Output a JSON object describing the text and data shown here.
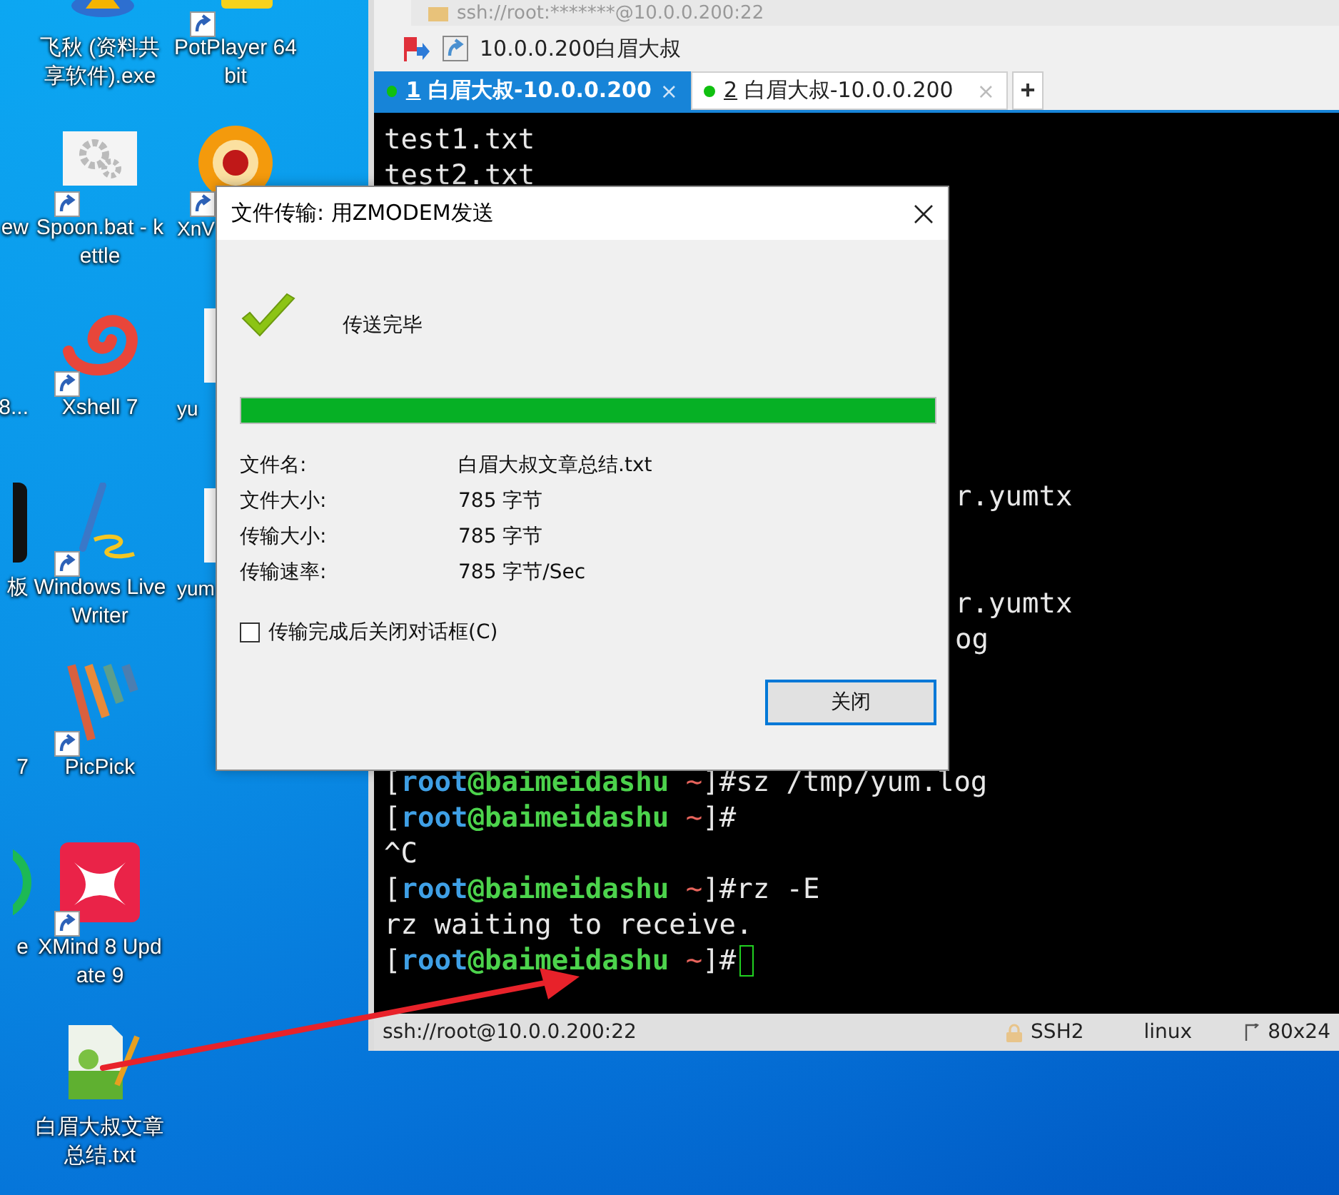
{
  "desktop": {
    "columns": [
      {
        "icons": [
          {
            "label": "ew",
            "kind": "cut"
          },
          {
            "label": "8...",
            "kind": "cut"
          },
          {
            "label": "板",
            "kind": "cut"
          },
          {
            "label": "7",
            "kind": "cut"
          },
          {
            "label": "e",
            "kind": "cut"
          }
        ]
      },
      {
        "icons": [
          {
            "label": "飞秋 (资料共享软件).exe",
            "kind": "full",
            "shortcut": false
          },
          {
            "label": "Spoon.bat - kettle",
            "kind": "full",
            "shortcut": true
          },
          {
            "label": "Xshell 7",
            "kind": "full",
            "shortcut": true
          },
          {
            "label": "Windows Live Writer",
            "kind": "full",
            "shortcut": true
          },
          {
            "label": "PicPick",
            "kind": "full",
            "shortcut": true
          },
          {
            "label": "XMind 8 Update 9",
            "kind": "full",
            "shortcut": true
          },
          {
            "label": "白眉大叔文章总结.txt",
            "kind": "full",
            "shortcut": false
          }
        ]
      },
      {
        "icons": [
          {
            "label": "PotPlayer 64 bit",
            "kind": "full",
            "shortcut": true
          },
          {
            "label": "XnV",
            "kind": "cut",
            "shortcut": true
          },
          {
            "label": "yu",
            "kind": "cut",
            "shortcut": false
          },
          {
            "label": "yum",
            "kind": "cut",
            "shortcut": false
          }
        ]
      }
    ]
  },
  "terminal_window": {
    "address": "ssh://root:*******@10.0.0.200:22",
    "session": "10.0.0.200白眉大叔",
    "tabs": [
      {
        "number": "1",
        "title": "白眉大叔-10.0.0.200",
        "close": "×",
        "selected": true,
        "connected": true
      },
      {
        "number": "2",
        "title": "白眉大叔-10.0.0.200",
        "close": "×",
        "selected": false,
        "connected": true
      }
    ],
    "new_tab": "+",
    "terminal": {
      "groups": [
        {
          "kind": "full",
          "lines": [
            {
              "segments": [
                {
                  "text": "test1.txt",
                  "kind": "plain"
                }
              ]
            },
            {
              "segments": [
                {
                  "text": "test2.txt",
                  "kind": "plain"
                }
              ]
            }
          ]
        },
        {
          "kind": "beside",
          "lines": [
            {
              "segments": [
                {
                  "text": "r.yumtx",
                  "kind": "plain"
                }
              ]
            }
          ]
        },
        {
          "kind": "beside",
          "lines": [
            {
              "segments": [
                {
                  "text": "r.yumtx",
                  "kind": "plain"
                }
              ]
            },
            {
              "segments": [
                {
                  "text": "og",
                  "kind": "plain"
                }
              ]
            }
          ]
        },
        {
          "kind": "full",
          "lines": [
            {
              "segments": [
                {
                  "text": "[",
                  "kind": "plain"
                },
                {
                  "text": "root",
                  "kind": "user"
                },
                {
                  "text": "@baimeidashu",
                  "kind": "host"
                },
                {
                  "text": " ~",
                  "kind": "dir"
                },
                {
                  "text": "]#sz /tmp/yum.log",
                  "kind": "plain"
                }
              ]
            },
            {
              "segments": [
                {
                  "text": "[",
                  "kind": "plain"
                },
                {
                  "text": "root",
                  "kind": "user"
                },
                {
                  "text": "@baimeidashu",
                  "kind": "host"
                },
                {
                  "text": " ~",
                  "kind": "dir"
                },
                {
                  "text": "]#",
                  "kind": "plain"
                }
              ]
            },
            {
              "segments": [
                {
                  "text": "^C",
                  "kind": "plain"
                }
              ]
            },
            {
              "segments": [
                {
                  "text": "[",
                  "kind": "plain"
                },
                {
                  "text": "root",
                  "kind": "user"
                },
                {
                  "text": "@baimeidashu",
                  "kind": "host"
                },
                {
                  "text": " ~",
                  "kind": "dir"
                },
                {
                  "text": "]#rz -E",
                  "kind": "plain"
                }
              ]
            },
            {
              "segments": [
                {
                  "text": "rz waiting to receive.",
                  "kind": "plain"
                }
              ]
            },
            {
              "segments": [
                {
                  "text": "[",
                  "kind": "plain"
                },
                {
                  "text": "root",
                  "kind": "user"
                },
                {
                  "text": "@baimeidashu",
                  "kind": "host"
                },
                {
                  "text": " ~",
                  "kind": "dir"
                },
                {
                  "text": "]#",
                  "kind": "plain"
                }
              ],
              "cursor": true
            }
          ]
        }
      ]
    },
    "status_bar": {
      "address": "ssh://root@10.0.0.200:22",
      "protocol": "SSH2",
      "terminal_type": "linux",
      "size": "80x24"
    }
  },
  "dialog": {
    "title": "文件传输: 用ZMODEM发送",
    "status": "传送完毕",
    "progress": {
      "level": 1
    },
    "fields": [
      {
        "label": "文件名:",
        "value": "白眉大叔文章总结.txt"
      },
      {
        "label": "文件大小:",
        "value": "785 字节"
      },
      {
        "label": "传输大小:",
        "value": "785 字节"
      },
      {
        "label": "传输速率:",
        "value": "785 字节/Sec"
      }
    ],
    "close_on_finish": {
      "label": "传输完成后关闭对话框(C)",
      "checked": false
    },
    "button": {
      "label": "关闭",
      "default": true
    }
  }
}
